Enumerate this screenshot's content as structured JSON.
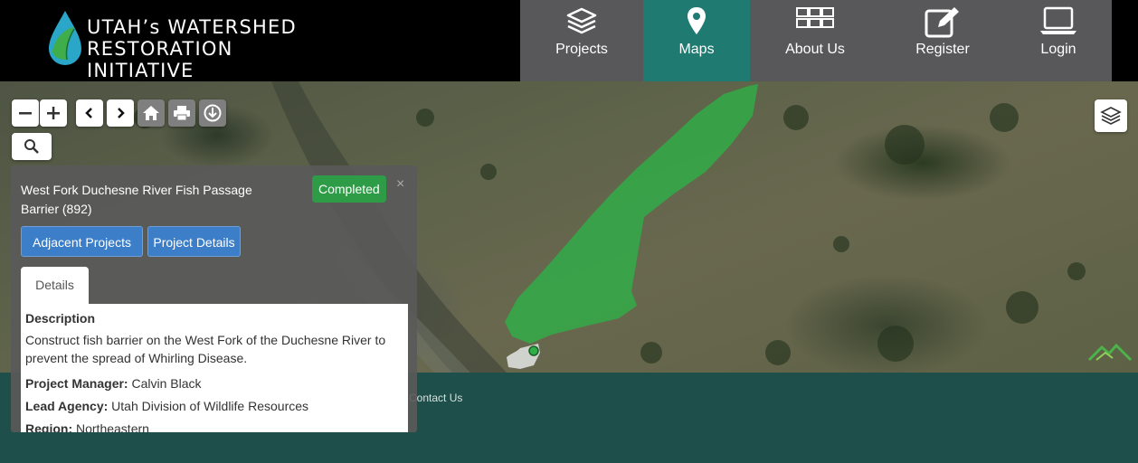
{
  "header": {
    "logo_line1": "UTAH’s WATERSHED",
    "logo_line2": "RESTORATION INITIATIVE",
    "nav": [
      {
        "label": "Projects",
        "icon": "layers-icon",
        "active": false
      },
      {
        "label": "Maps",
        "icon": "map-pin-icon",
        "active": true
      },
      {
        "label": "About Us",
        "icon": "grid-icon",
        "active": false
      },
      {
        "label": "Register",
        "icon": "edit-icon",
        "active": false
      },
      {
        "label": "Login",
        "icon": "laptop-icon",
        "active": false
      }
    ]
  },
  "map": {
    "tools": [
      "zoom-out",
      "zoom-in",
      "back",
      "forward",
      "home",
      "print",
      "download",
      "search"
    ],
    "polygon_color": "#2fae48"
  },
  "popup": {
    "title": "West Fork Duchesne River Fish Passage Barrier (892)",
    "status": "Completed",
    "close": "×",
    "adjacent_btn": "Adjacent Projects",
    "details_btn": "Project Details",
    "tab_label": "Details",
    "description_heading": "Description",
    "description": "Construct fish barrier on the West Fork of the Duchesne River to prevent the spread of Whirling Disease.",
    "manager_label": "Project Manager:",
    "manager": "Calvin Black",
    "agency_label": "Lead Agency:",
    "agency": "Utah Division of Wildlife Resources",
    "region_label": "Region:",
    "region": "Northeastern"
  },
  "footer": {
    "contact": "Contact Us"
  }
}
